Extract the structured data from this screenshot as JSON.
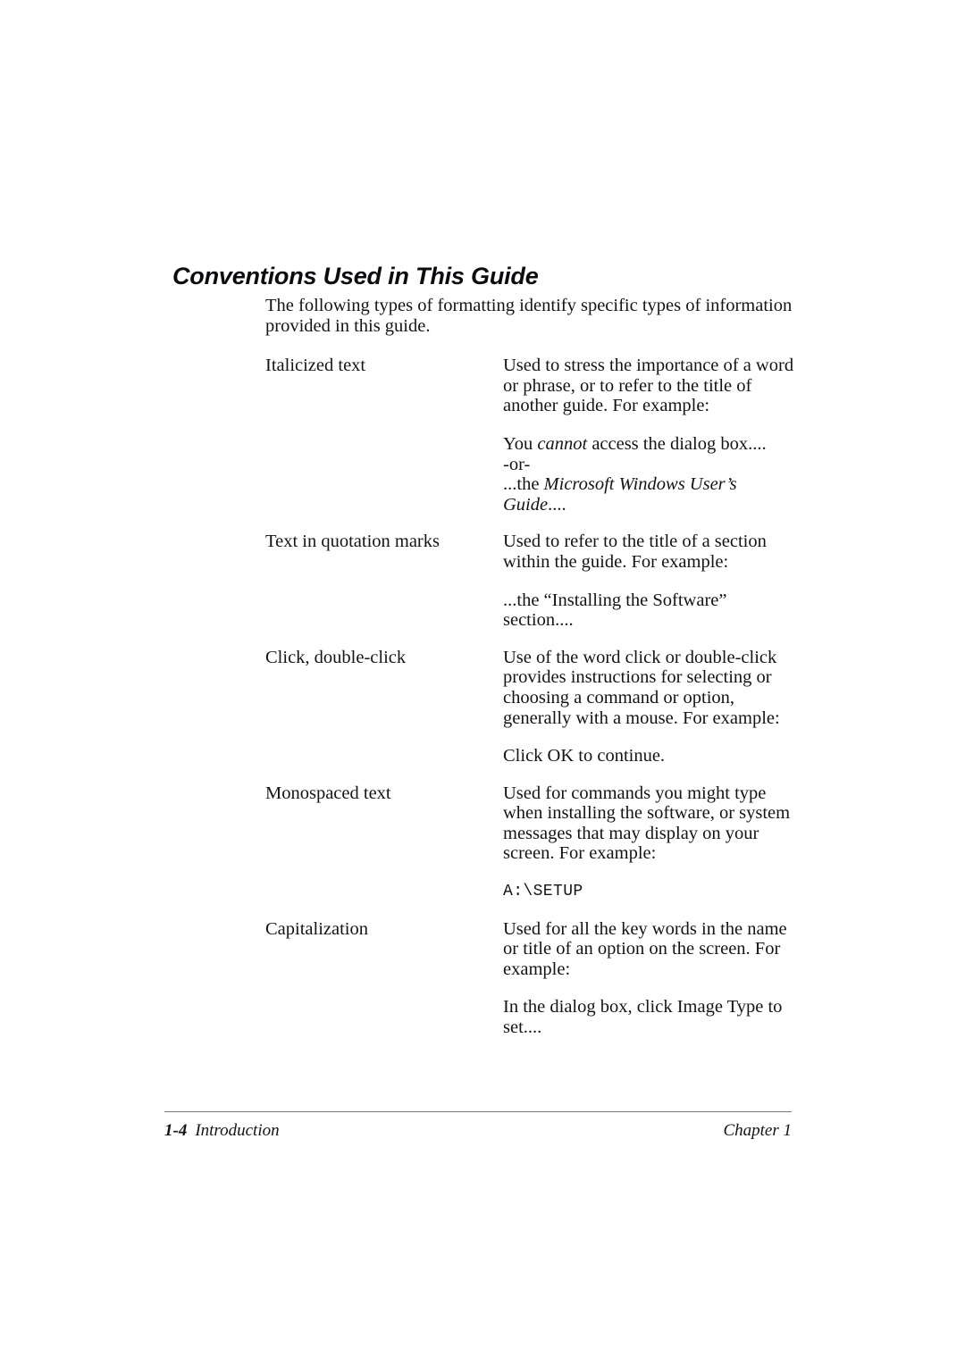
{
  "document": {
    "heading": "Conventions Used in This Guide",
    "intro": "The following types of formatting identify specific types of information provided in this guide.",
    "conventions": [
      {
        "term": "Italicized text",
        "description": "Used to stress the importance of a word or phrase, or to refer to the title of another guide. For example:",
        "example_lines": [
          "You cannot access the dialog box....",
          "-or-",
          "...the Microsoft Windows User’s Guide...."
        ],
        "example_italic_parts": [
          "cannot",
          "Microsoft Windows User’s Guide"
        ],
        "example_style": "serif"
      },
      {
        "term": "Text in quotation marks",
        "description": "Used to refer to the title of a section within the guide. For example:",
        "example_lines": [
          "...the “Installing the Software” section...."
        ],
        "example_italic_parts": [],
        "example_style": "serif"
      },
      {
        "term": "Click, double-click",
        "description": "Use of the word click or double-click provides instructions for selecting or choosing a command or option, generally with a mouse. For example:",
        "example_lines": [
          "Click OK to continue."
        ],
        "example_italic_parts": [],
        "example_style": "serif"
      },
      {
        "term": "Monospaced text",
        "description": "Used for commands you might type when installing the software, or system messages that may display on your screen. For example:",
        "example_lines": [
          "A:\\SETUP"
        ],
        "example_italic_parts": [],
        "example_style": "monospace"
      },
      {
        "term": "Capitalization",
        "description": "Used for all the key words in the name or title of an option on the screen. For example:",
        "example_lines": [
          "In the dialog box, click Image Type to set...."
        ],
        "example_italic_parts": [],
        "example_style": "serif"
      }
    ]
  },
  "footer": {
    "page_number": "1-4",
    "section": "Introduction",
    "chapter": "Chapter 1",
    "rule_color": "#77777c"
  }
}
